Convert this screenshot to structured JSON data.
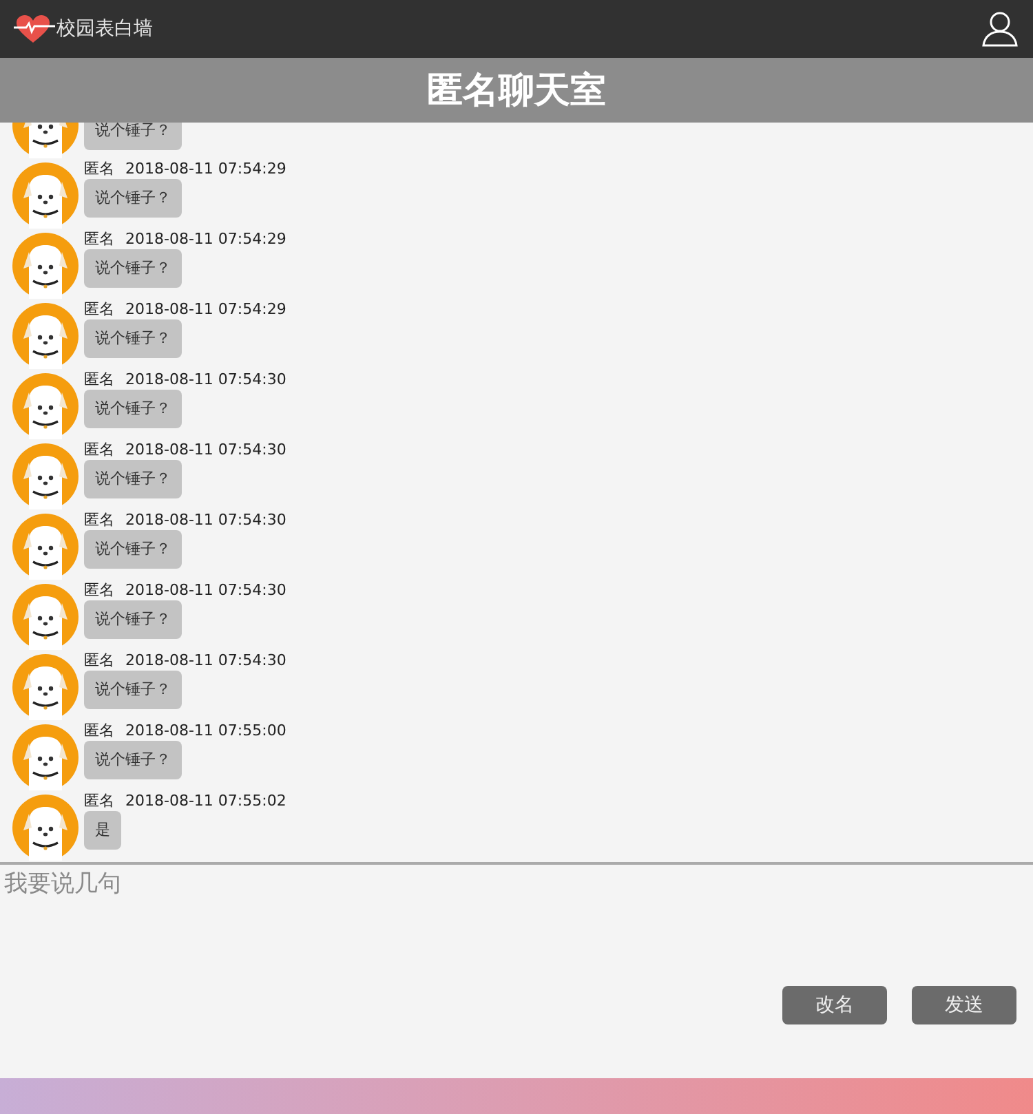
{
  "header": {
    "brand": "校园表白墙"
  },
  "title": "匿名聊天室",
  "messages": [
    {
      "text": "说个锤子？"
    },
    {
      "name": "匿名",
      "time": "2018-08-11 07:54:29",
      "text": "说个锤子？"
    },
    {
      "name": "匿名",
      "time": "2018-08-11 07:54:29",
      "text": "说个锤子？"
    },
    {
      "name": "匿名",
      "time": "2018-08-11 07:54:29",
      "text": "说个锤子？"
    },
    {
      "name": "匿名",
      "time": "2018-08-11 07:54:30",
      "text": "说个锤子？"
    },
    {
      "name": "匿名",
      "time": "2018-08-11 07:54:30",
      "text": "说个锤子？"
    },
    {
      "name": "匿名",
      "time": "2018-08-11 07:54:30",
      "text": "说个锤子？"
    },
    {
      "name": "匿名",
      "time": "2018-08-11 07:54:30",
      "text": "说个锤子？"
    },
    {
      "name": "匿名",
      "time": "2018-08-11 07:54:30",
      "text": "说个锤子？"
    },
    {
      "name": "匿名",
      "time": "2018-08-11 07:55:00",
      "text": "说个锤子？"
    },
    {
      "name": "匿名",
      "time": "2018-08-11 07:55:02",
      "text": "是"
    }
  ],
  "composer": {
    "placeholder": "我要说几句"
  },
  "buttons": [
    "改名",
    "发送"
  ]
}
